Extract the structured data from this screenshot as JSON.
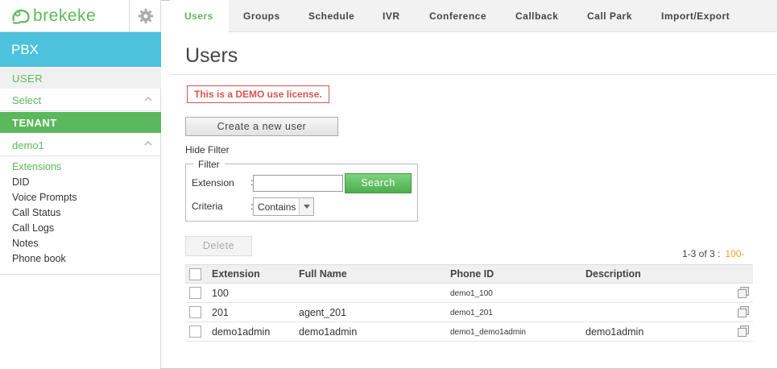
{
  "app": {
    "brand": "brekeke",
    "section": "PBX"
  },
  "sidebar": {
    "user_header": "USER",
    "select_label": "Select",
    "tenant_header": "TENANT",
    "tenant_name": "demo1",
    "items": [
      {
        "label": "Extensions",
        "active": true
      },
      {
        "label": "DID"
      },
      {
        "label": "Voice Prompts"
      },
      {
        "label": "Call Status"
      },
      {
        "label": "Call Logs"
      },
      {
        "label": "Notes"
      },
      {
        "label": "Phone book"
      }
    ]
  },
  "tabs": [
    {
      "label": "Users",
      "active": true
    },
    {
      "label": "Groups"
    },
    {
      "label": "Schedule"
    },
    {
      "label": "IVR"
    },
    {
      "label": "Conference"
    },
    {
      "label": "Callback"
    },
    {
      "label": "Call Park"
    },
    {
      "label": "Import/Export"
    }
  ],
  "main": {
    "title": "Users",
    "license_notice": "This is a DEMO use license.",
    "create_button": "Create a new user",
    "hide_filter": "Hide Filter",
    "filter": {
      "legend": "Filter",
      "extension_label": "Extension",
      "extension_value": "",
      "search_button": "Search",
      "criteria_label": "Criteria",
      "criteria_value": "Contains"
    },
    "delete_button": "Delete",
    "pager": {
      "range": "1-3 of 3 :",
      "page_size": "100-"
    },
    "table": {
      "columns": [
        "Extension",
        "Full Name",
        "Phone ID",
        "Description"
      ],
      "rows": [
        {
          "extension": "100",
          "full_name": "",
          "phone_id": "demo1_100",
          "description": ""
        },
        {
          "extension": "201",
          "full_name": "agent_201",
          "phone_id": "demo1_201",
          "description": ""
        },
        {
          "extension": "demo1admin",
          "full_name": "demo1admin",
          "phone_id": "demo1_demo1admin",
          "description": "demo1admin"
        }
      ]
    }
  },
  "colors": {
    "accent_green": "#5cb85c",
    "pbx_blue": "#4cc2dd",
    "alert_red": "#d9534f",
    "pager_orange": "#f0a030"
  }
}
